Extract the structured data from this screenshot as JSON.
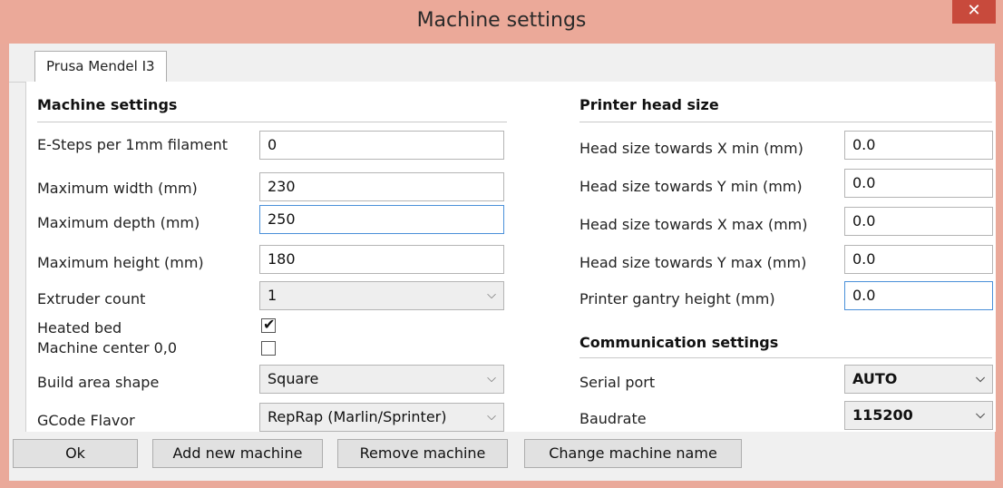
{
  "window": {
    "title": "Machine settings",
    "close_glyph": "✕",
    "close_icon": "close-icon"
  },
  "tabs": [
    {
      "label": "Prusa Mendel I3"
    }
  ],
  "machine": {
    "section_title": "Machine settings",
    "esteps_label": "E-Steps per 1mm filament",
    "esteps_value": "0",
    "width_label": "Maximum width (mm)",
    "width_value": "230",
    "depth_label": "Maximum depth (mm)",
    "depth_value": "250",
    "height_label": "Maximum height (mm)",
    "height_value": "180",
    "extruder_label": "Extruder count",
    "extruder_value": "1",
    "heated_bed_label": "Heated bed",
    "heated_bed_checked": true,
    "center_label": "Machine center 0,0",
    "center_checked": false,
    "shape_label": "Build area shape",
    "shape_value": "Square",
    "flavor_label": "GCode Flavor",
    "flavor_value": "RepRap (Marlin/Sprinter)"
  },
  "head": {
    "section_title": "Printer head size",
    "xmin_label": "Head size towards X min (mm)",
    "xmin_value": "0.0",
    "ymin_label": "Head size towards Y min (mm)",
    "ymin_value": "0.0",
    "xmax_label": "Head size towards X max (mm)",
    "xmax_value": "0.0",
    "ymax_label": "Head size towards Y max (mm)",
    "ymax_value": "0.0",
    "gantry_label": "Printer gantry height (mm)",
    "gantry_value": "0.0"
  },
  "comm": {
    "section_title": "Communication settings",
    "port_label": "Serial port",
    "port_value": "AUTO",
    "baud_label": "Baudrate",
    "baud_value": "115200"
  },
  "icons": {
    "chevron": "⌵",
    "check": "✔"
  },
  "buttons": {
    "ok": "Ok",
    "add": "Add new machine",
    "remove": "Remove machine",
    "rename": "Change machine name"
  },
  "colors": {
    "titlebar": "#eba999",
    "close": "#c84a3c",
    "focus": "#4a90d9"
  }
}
